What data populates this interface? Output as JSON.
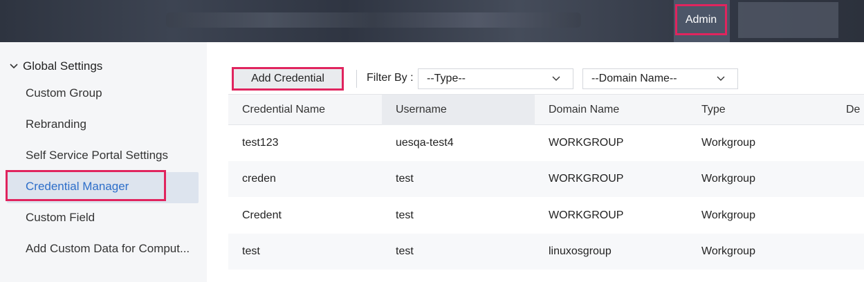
{
  "header": {
    "active_tab": "Admin"
  },
  "sidebar": {
    "section_title": "Global Settings",
    "items": [
      {
        "label": "Custom Group"
      },
      {
        "label": "Rebranding"
      },
      {
        "label": "Self Service Portal Settings"
      },
      {
        "label": "Credential Manager",
        "active": true
      },
      {
        "label": "Custom Field"
      },
      {
        "label": "Add Custom Data for Comput..."
      }
    ]
  },
  "toolbar": {
    "add_label": "Add Credential",
    "filter_label": "Filter By :",
    "type_select": "--Type--",
    "domain_select": "--Domain Name--"
  },
  "table": {
    "columns": [
      "Credential Name",
      "Username",
      "Domain Name",
      "Type",
      "De"
    ],
    "rows": [
      [
        "test123",
        "uesqa-test4",
        "WORKGROUP",
        "Workgroup"
      ],
      [
        "creden",
        "test",
        "WORKGROUP",
        "Workgroup"
      ],
      [
        "Credent",
        "test",
        "WORKGROUP",
        "Workgroup"
      ],
      [
        "test",
        "test",
        "linuxosgroup",
        "Workgroup"
      ]
    ]
  },
  "colors": {
    "highlight": "#e0245e",
    "active_link": "#2d6ec9",
    "topbar": "#2e3440"
  }
}
